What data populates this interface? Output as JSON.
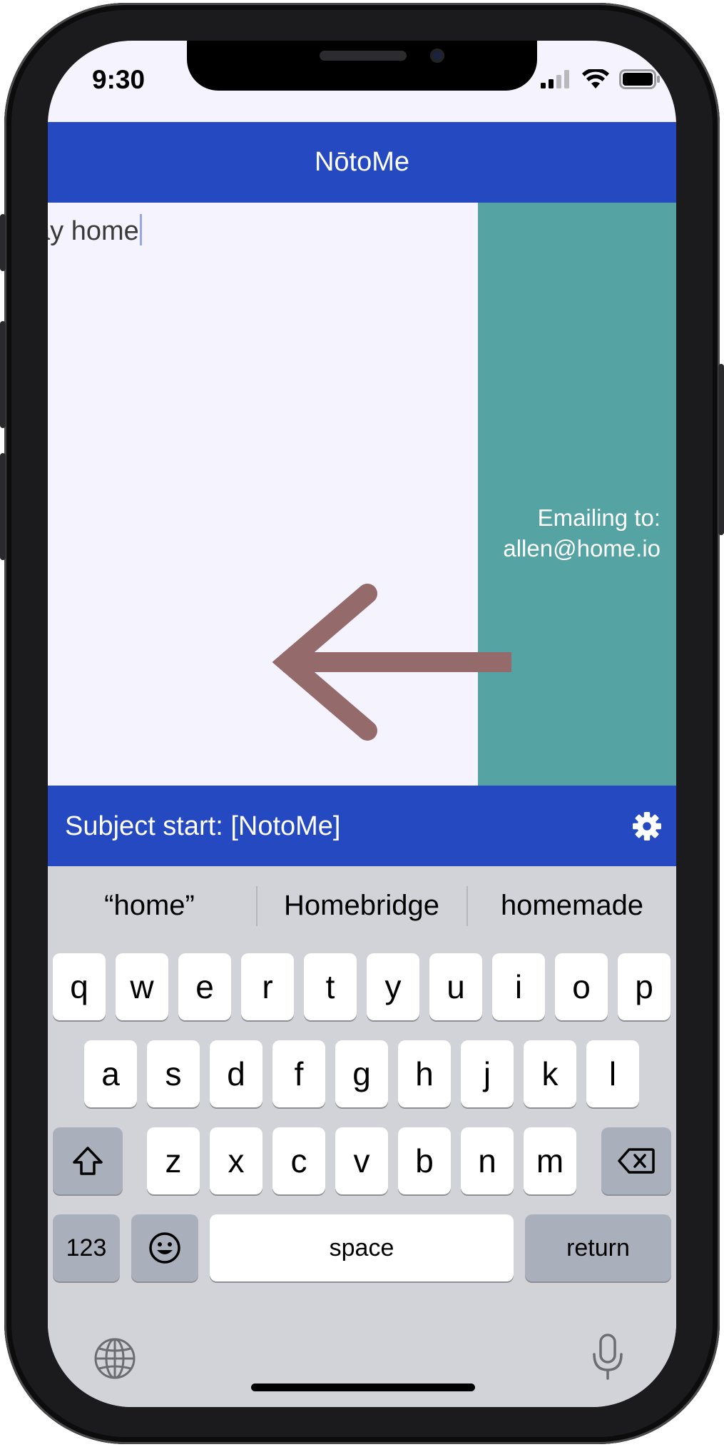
{
  "status_bar": {
    "time": "9:30",
    "icons": [
      "cellular-signal-icon",
      "wifi-icon",
      "battery-icon"
    ]
  },
  "header": {
    "title": "NōtoMe"
  },
  "note": {
    "text": "ay home"
  },
  "email_panel": {
    "line1": "Emailing to:",
    "line2": "allen@home.io"
  },
  "subject_bar": {
    "text": "Subject start: [NotoMe]",
    "icon": "gear-icon"
  },
  "keyboard": {
    "suggestions": [
      "“home”",
      "Homebridge",
      "homemade"
    ],
    "row1": [
      "q",
      "w",
      "e",
      "r",
      "t",
      "y",
      "u",
      "i",
      "o",
      "p"
    ],
    "row2": [
      "a",
      "s",
      "d",
      "f",
      "g",
      "h",
      "j",
      "k",
      "l"
    ],
    "row3": [
      "z",
      "x",
      "c",
      "v",
      "b",
      "n",
      "m"
    ],
    "numbers_label": "123",
    "space_label": "space",
    "return_label": "return",
    "icons": [
      "shift-icon",
      "backspace-icon",
      "emoji-icon",
      "globe-icon",
      "microphone-icon"
    ]
  },
  "colors": {
    "accent_blue": "#2449c0",
    "teal": "#55a3a3",
    "arrow": "#956a6a",
    "background": "#f5f3fd"
  }
}
